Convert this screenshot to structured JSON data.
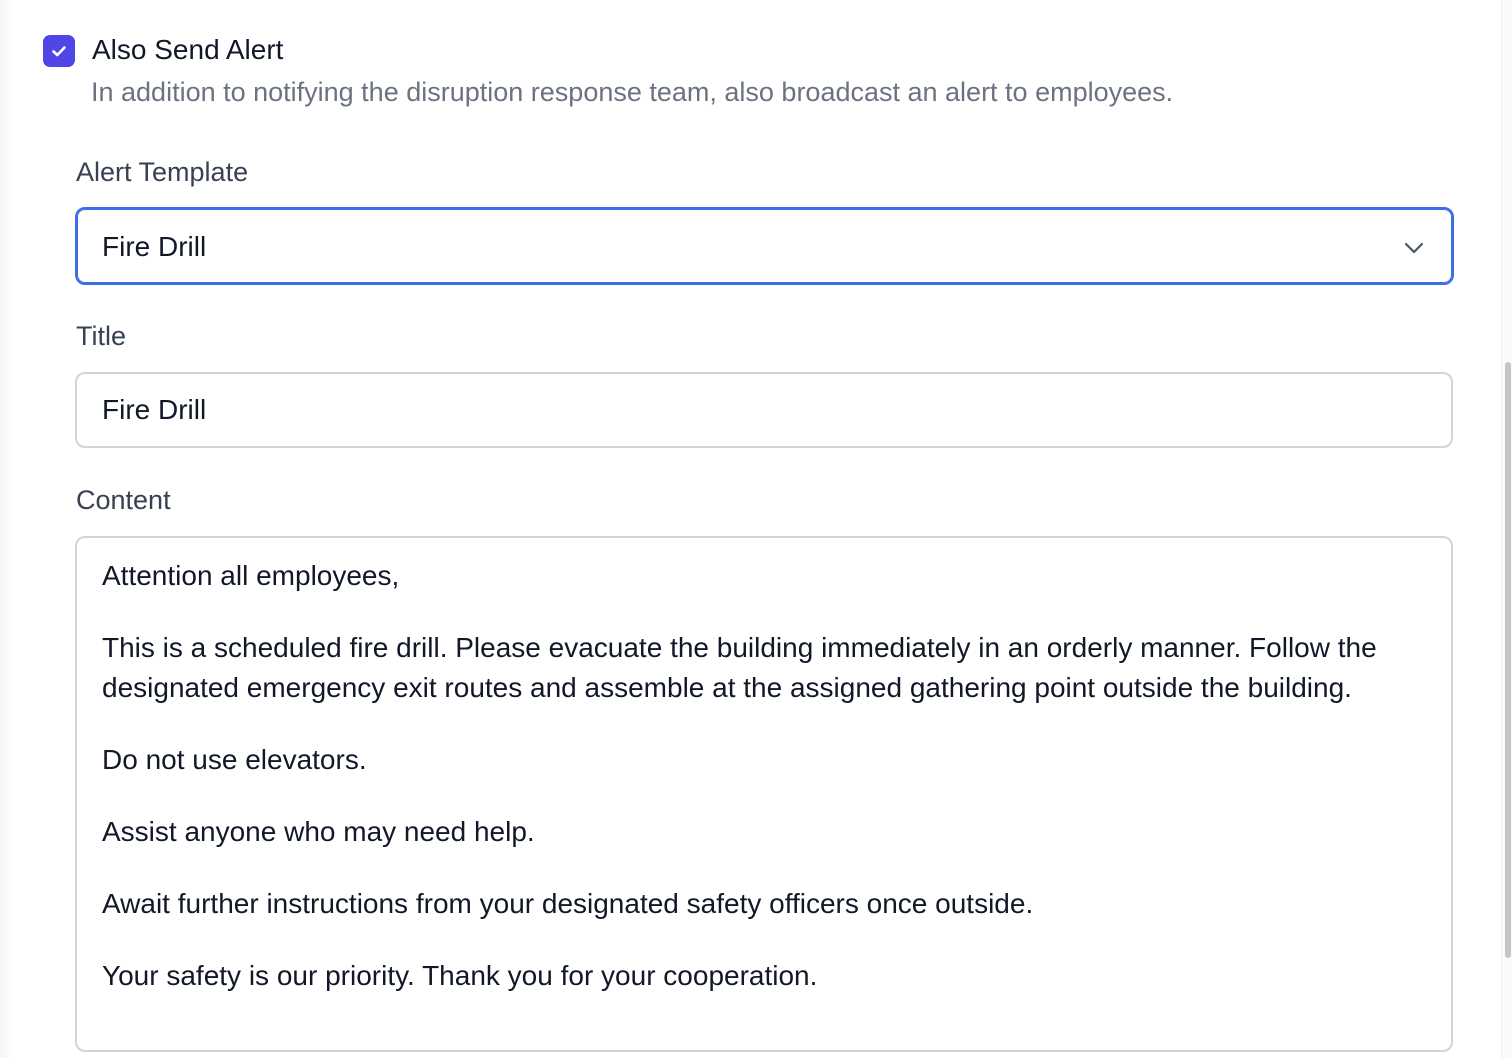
{
  "alert_option": {
    "checked": true,
    "label": "Also Send Alert",
    "description": "In addition to notifying the disruption response team, also broadcast an alert to employees."
  },
  "template_field": {
    "label": "Alert Template",
    "selected": "Fire Drill"
  },
  "title_field": {
    "label": "Title",
    "value": "Fire Drill"
  },
  "content_field": {
    "label": "Content",
    "paragraphs": [
      "Attention all employees,",
      "This is a scheduled fire drill. Please evacuate the building immediately in an orderly manner. Follow the designated emergency exit routes and assemble at the assigned gathering point outside the building.",
      "Do not use elevators.",
      "Assist anyone who may need help.",
      "Await further instructions from your designated safety officers once outside.",
      "Your safety is our priority. Thank you for your cooperation."
    ]
  },
  "colors": {
    "accent": "#4f46e5",
    "focus_border": "#3b6fe8",
    "input_border": "#d1d5db",
    "muted_text": "#6b7280"
  },
  "icons": {
    "checkbox": "check-icon",
    "select": "chevron-down-icon"
  }
}
